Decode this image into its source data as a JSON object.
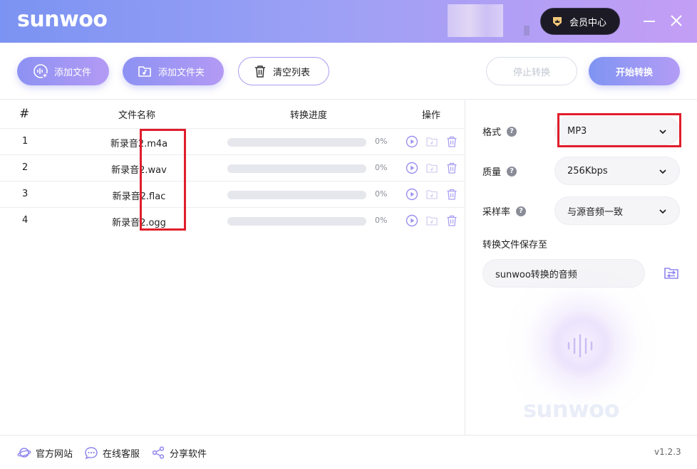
{
  "header": {
    "logo": "sunwoo",
    "vip_label": "会员中心"
  },
  "toolbar": {
    "add_file": "添加文件",
    "add_folder": "添加文件夹",
    "clear_list": "清空列表",
    "stop": "停止转换",
    "start": "开始转换"
  },
  "table": {
    "headers": {
      "index": "#",
      "filename": "文件名称",
      "progress": "转换进度",
      "actions": "操作"
    },
    "rows": [
      {
        "index": "1",
        "filename": "新录音2.m4a",
        "progress_pct": 0,
        "progress_label": "0%"
      },
      {
        "index": "2",
        "filename": "新录音2.wav",
        "progress_pct": 0,
        "progress_label": "0%"
      },
      {
        "index": "3",
        "filename": "新录音2.flac",
        "progress_pct": 0,
        "progress_label": "0%"
      },
      {
        "index": "4",
        "filename": "新录音2.ogg",
        "progress_pct": 0,
        "progress_label": "0%"
      }
    ]
  },
  "settings": {
    "format_label": "格式",
    "format_value": "MP3",
    "quality_label": "质量",
    "quality_value": "256Kbps",
    "samplerate_label": "采样率",
    "samplerate_value": "与源音频一致",
    "save_to_label": "转换文件保存至",
    "save_to_value": "sunwoo转换的音频",
    "watermark": "sunwoo"
  },
  "footer": {
    "website": "官方网站",
    "support": "在线客服",
    "share": "分享软件",
    "version": "v1.2.3"
  },
  "colors": {
    "accent": "#9a97f3",
    "highlight_red": "#e01e2b"
  }
}
